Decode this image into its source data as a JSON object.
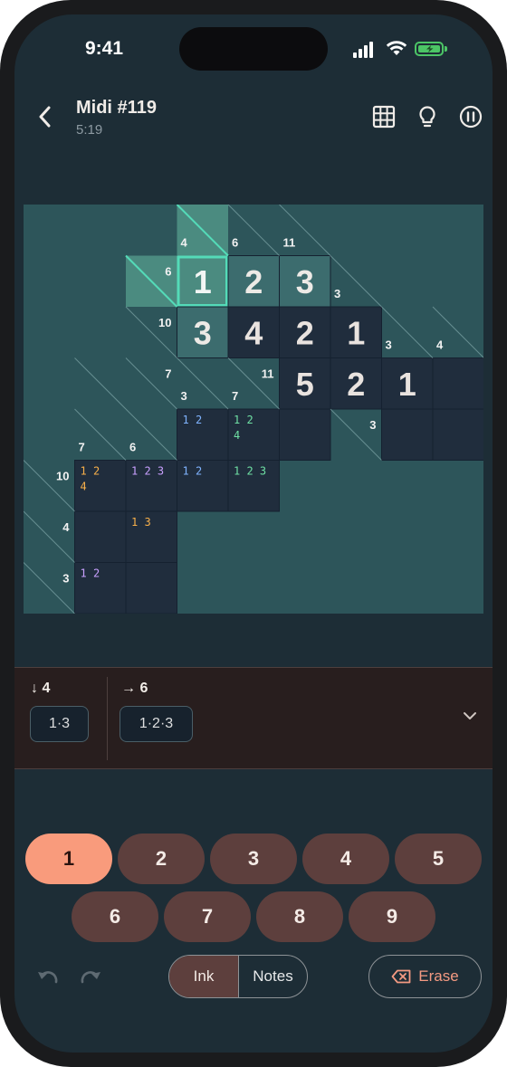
{
  "status_bar": {
    "time": "9:41",
    "battery_status": "charging"
  },
  "header": {
    "title": "Midi #119",
    "timer": "5:19"
  },
  "icons": {
    "back": "chevron-left-icon",
    "grid": "grid-icon",
    "hint": "lightbulb-icon",
    "pause": "pause-circle-icon",
    "expand": "chevron-down-icon",
    "undo": "undo-icon",
    "redo": "redo-icon",
    "erase": "backspace-icon"
  },
  "colors": {
    "background": "#1d2d36",
    "board_background": "#2d555a",
    "empty_cell": "#202d3d",
    "selected_cell": "#4b8b80",
    "highlight": "#54dbb8",
    "accent": "#f99b7c",
    "button": "#5d3f3d",
    "note_blue": "#7fb3ff",
    "note_green": "#6fe0a4",
    "note_orange": "#f8b04a",
    "note_purple": "#c9a0ff"
  },
  "board": {
    "cells": [
      {
        "row": 1,
        "col": 3,
        "value": "1",
        "state": "selected"
      },
      {
        "row": 1,
        "col": 4,
        "value": "2",
        "state": "highlighted"
      },
      {
        "row": 1,
        "col": 5,
        "value": "3",
        "state": "highlighted"
      },
      {
        "row": 2,
        "col": 3,
        "value": "3",
        "state": "highlighted"
      },
      {
        "row": 2,
        "col": 4,
        "value": "4",
        "state": "filled"
      },
      {
        "row": 2,
        "col": 5,
        "value": "2",
        "state": "filled"
      },
      {
        "row": 2,
        "col": 6,
        "value": "1",
        "state": "filled"
      },
      {
        "row": 3,
        "col": 5,
        "value": "5",
        "state": "filled"
      },
      {
        "row": 3,
        "col": 6,
        "value": "2",
        "state": "filled"
      },
      {
        "row": 3,
        "col": 7,
        "value": "1",
        "state": "filled"
      },
      {
        "row": 3,
        "col": 8,
        "value": "",
        "state": "empty"
      },
      {
        "row": 4,
        "col": 3,
        "notes": [
          {
            "text": "1 2",
            "color": "blue"
          }
        ],
        "state": "empty"
      },
      {
        "row": 4,
        "col": 4,
        "notes": [
          {
            "text": "1 2",
            "color": "green"
          },
          {
            "text": "4",
            "color": "green"
          }
        ],
        "state": "empty"
      },
      {
        "row": 4,
        "col": 5,
        "value": "",
        "state": "empty"
      },
      {
        "row": 4,
        "col": 7,
        "value": "",
        "state": "empty"
      },
      {
        "row": 4,
        "col": 8,
        "value": "",
        "state": "empty"
      },
      {
        "row": 5,
        "col": 1,
        "notes": [
          {
            "text": "1 2",
            "color": "orange"
          },
          {
            "text": "4",
            "color": "orange"
          }
        ],
        "state": "empty"
      },
      {
        "row": 5,
        "col": 2,
        "notes": [
          {
            "text": "1 2 3",
            "color": "purple"
          }
        ],
        "state": "empty"
      },
      {
        "row": 5,
        "col": 3,
        "notes": [
          {
            "text": "1 2",
            "color": "blue"
          }
        ],
        "state": "empty"
      },
      {
        "row": 5,
        "col": 4,
        "notes": [
          {
            "text": "1 2 3",
            "color": "green"
          }
        ],
        "state": "empty"
      },
      {
        "row": 6,
        "col": 1,
        "value": "",
        "state": "empty"
      },
      {
        "row": 6,
        "col": 2,
        "notes": [
          {
            "text": "1   3",
            "color": "orange"
          }
        ],
        "state": "empty"
      },
      {
        "row": 7,
        "col": 1,
        "notes": [
          {
            "text": "1 2",
            "color": "purple"
          }
        ],
        "state": "empty"
      },
      {
        "row": 7,
        "col": 2,
        "value": "",
        "state": "empty"
      }
    ],
    "clues": [
      {
        "row": 0,
        "col": 3,
        "down": "4",
        "state": "selected"
      },
      {
        "row": 0,
        "col": 4,
        "down": "6"
      },
      {
        "row": 0,
        "col": 5,
        "down": "11"
      },
      {
        "row": 1,
        "col": 2,
        "across": "6",
        "state": "selected"
      },
      {
        "row": 1,
        "col": 6,
        "down": "3"
      },
      {
        "row": 2,
        "col": 2,
        "across": "10"
      },
      {
        "row": 2,
        "col": 7,
        "down": "3"
      },
      {
        "row": 2,
        "col": 8,
        "down": "4"
      },
      {
        "row": 3,
        "col": 3,
        "down": "3"
      },
      {
        "row": 3,
        "col": 4,
        "across": "11",
        "down": "7"
      },
      {
        "row": 3,
        "col": 1,
        "notch": true
      },
      {
        "row": 3,
        "col": 2,
        "across": "7"
      },
      {
        "row": 4,
        "col": 1,
        "down": "7"
      },
      {
        "row": 4,
        "col": 2,
        "down": "6"
      },
      {
        "row": 4,
        "col": 6,
        "across": "3"
      },
      {
        "row": 5,
        "col": 0,
        "across": "10"
      },
      {
        "row": 6,
        "col": 0,
        "across": "4"
      },
      {
        "row": 7,
        "col": 0,
        "across": "3"
      }
    ]
  },
  "clue_panel": {
    "down_sum": "4",
    "down_combos": [
      "1·3"
    ],
    "across_sum": "6",
    "across_combos": [
      "1·2·3"
    ]
  },
  "keypad": {
    "numbers": [
      "1",
      "2",
      "3",
      "4",
      "5",
      "6",
      "7",
      "8",
      "9"
    ],
    "selected": "1"
  },
  "controls": {
    "ink_label": "Ink",
    "notes_label": "Notes",
    "erase_label": "Erase",
    "mode": "Ink"
  }
}
